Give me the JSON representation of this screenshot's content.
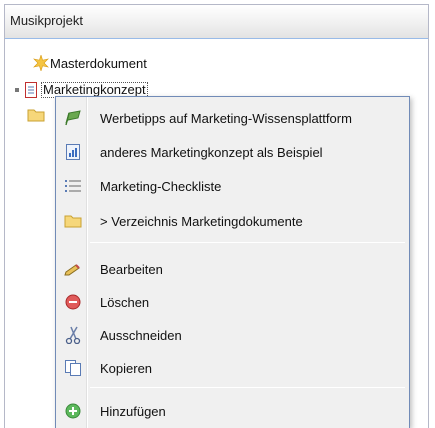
{
  "panel": {
    "title": "Musikprojekt"
  },
  "tree": {
    "nodes": [
      {
        "label": "Masterdokument",
        "icon": "star-burst-icon"
      },
      {
        "label": "Marketingkonzept",
        "icon": "document-icon"
      },
      {
        "label": "",
        "icon": "folder-icon"
      }
    ]
  },
  "context_menu": {
    "items": [
      {
        "label": "Werbetipps auf Marketing-Wissensplattform",
        "icon": "green-flag-icon"
      },
      {
        "label": "anderes Marketingkonzept als Beispiel",
        "icon": "chart-document-icon"
      },
      {
        "label": "Marketing-Checkliste",
        "icon": "checklist-icon"
      },
      {
        "label": "> Verzeichnis Marketingdokumente",
        "icon": "folder-icon"
      },
      {
        "label": "Bearbeiten",
        "icon": "pencil-icon"
      },
      {
        "label": "Löschen",
        "icon": "delete-icon"
      },
      {
        "label": "Ausschneiden",
        "icon": "scissors-icon"
      },
      {
        "label": "Kopieren",
        "icon": "copy-icon"
      },
      {
        "label": "Hinzufügen",
        "icon": "add-icon"
      }
    ]
  },
  "colors": {
    "header_border": "#99bbe8",
    "menu_border": "#718bb7",
    "menu_bg": "#f0f0f0"
  }
}
